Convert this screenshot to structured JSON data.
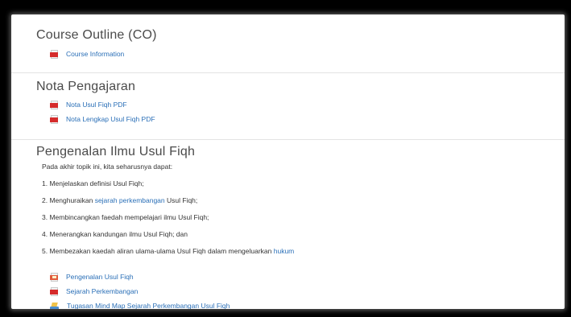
{
  "sections": {
    "course_outline": {
      "title": "Course Outline (CO)",
      "items": [
        {
          "label": "Course Information",
          "icon": "pdf-icon"
        }
      ]
    },
    "nota": {
      "title": "Nota Pengajaran",
      "items": [
        {
          "label": "Nota Usul Fiqh PDF",
          "icon": "pdf-icon"
        },
        {
          "label": "Nota Lengkap Usul Fiqh PDF",
          "icon": "pdf-icon"
        }
      ]
    },
    "pengenalan": {
      "title": "Pengenalan Ilmu Usul Fiqh",
      "intro": "Pada akhir topik ini, kita seharusnya dapat:",
      "objectives": [
        {
          "pre": "1. Menjelaskan definisi Usul Fiqh;",
          "link": "",
          "post": ""
        },
        {
          "pre": "2. Menghuraikan ",
          "link": "sejarah perkembangan",
          "post": " Usul Fiqh;"
        },
        {
          "pre": "3. Membincangkan faedah mempelajari ilmu Usul Fiqh;",
          "link": "",
          "post": ""
        },
        {
          "pre": "4. Menerangkan kandungan ilmu Usul Fiqh; dan",
          "link": "",
          "post": ""
        },
        {
          "pre": "5. Membezakan kaedah aliran ulama-ulama Usul Fiqh dalam mengeluarkan ",
          "link": "hukum",
          "post": ""
        }
      ],
      "items": [
        {
          "label": "Pengenalan Usul Fiqh",
          "icon": "powerpoint-icon"
        },
        {
          "label": "Sejarah Perkembangan",
          "icon": "pdf-icon"
        },
        {
          "label": "Tugasan Mind Map Sejarah Perkembangan Usul Fiqh",
          "icon": "assignment-icon"
        }
      ]
    }
  },
  "colors": {
    "link": "#2a6fb7",
    "heading": "#4a4a4a",
    "pdf_red": "#d52b2b"
  }
}
